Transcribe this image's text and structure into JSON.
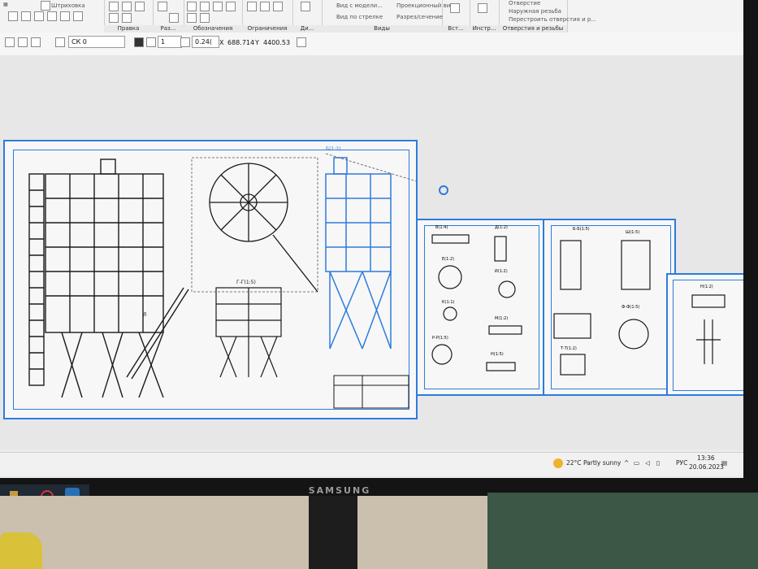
{
  "ribbon": {
    "tool_shtrikhovka": "Штриховка",
    "groups": [
      {
        "label": "Правка"
      },
      {
        "label": "Раз..."
      },
      {
        "label": "Обозначения"
      },
      {
        "label": "Ограничения"
      },
      {
        "label": "Ди..."
      },
      {
        "label": "Виды"
      },
      {
        "label": "Вст..."
      },
      {
        "label": "Инстр..."
      },
      {
        "label": "Отверстия и резьбы"
      }
    ],
    "view_items": [
      "Вид с модели...",
      "Вид по стрелке",
      "Проекционный вид",
      "Разрез/сечение"
    ],
    "hole_items": [
      "Отверстие",
      "Наружная резьба",
      "Перестроить отверстия и р..."
    ]
  },
  "toolbar": {
    "cs_label": "СК 0",
    "step_value": "1",
    "zoom_value": "0.24(",
    "coord_x_label": "X",
    "coord_x_value": "688.714",
    "coord_y_label": "Y",
    "coord_y_value": "4400.53"
  },
  "drawing": {
    "main_sheet_labels": [
      "Б(1:2)",
      "Г-Г(1:5)",
      "Л"
    ],
    "sheet2_labels": [
      "В(1:4)",
      "Д(1:2)",
      "Е(1:2)",
      "И(1:2)",
      "К(1:1)",
      "М(1:2)",
      "Р-Р(1:5)",
      "Н(1:5)"
    ],
    "sheet3_labels": [
      "Б-Б(1:5)",
      "Ш(1:5)",
      "Ф-Ф(1:5)",
      "Т-Т(1:2)"
    ],
    "sheet4_labels": [
      "Н(1:2)"
    ]
  },
  "taskbar": {
    "weather_temp": "22°C",
    "weather_desc": "Partly sunny",
    "language": "РУС",
    "time": "13:36",
    "date": "20.06.2023"
  },
  "monitor": {
    "brand": "SAMSUNG"
  },
  "colors": {
    "selection_blue": "#2d7bdc",
    "drawing_black": "#1a1a1a"
  }
}
